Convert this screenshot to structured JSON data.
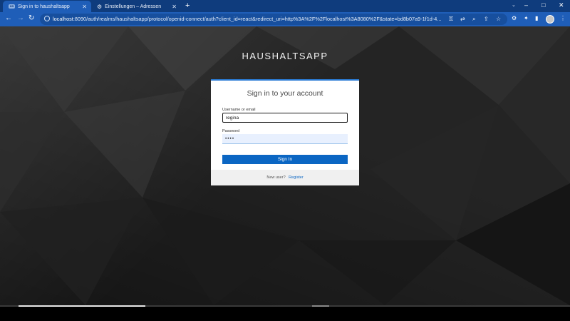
{
  "browser": {
    "tabs": [
      {
        "favicon_text": "HS",
        "label": "Sign in to haushaltsapp",
        "active": true
      },
      {
        "favicon_icon": "gear-icon",
        "label": "Einstellungen – Adressen",
        "active": false
      }
    ],
    "new_tab": "+",
    "window_controls": {
      "minimize": "–",
      "maximize": "□",
      "close": "✕"
    },
    "tab_search": "⌄",
    "nav": {
      "back": "←",
      "forward": "→",
      "reload": "↻"
    },
    "url": {
      "host": "localhost",
      "rest": ":8090/auth/realms/haushaltsapp/protocol/openid-connect/auth?client_id=react&redirect_uri=http%3A%2F%2Flocalhost%3A8080%2F&state=bd8b07a9-1f1d-4..."
    },
    "url_icons": {
      "key": "⚿",
      "translate": "⇄",
      "zoom": "⌕",
      "share": "⇪",
      "bookmark": "☆"
    },
    "extension_icons": {
      "extension_a": "⚙",
      "puzzle": "✦",
      "sidebar": "▮",
      "menu": "⋮"
    }
  },
  "page": {
    "realm_title": "HAUSHALTSAPP",
    "card_title": "Sign in to your account",
    "username_label": "Username or email",
    "username_value": "regina",
    "password_label": "Password",
    "password_value": "••••",
    "signin_label": "Sign In",
    "new_user_text": "New user?",
    "register_label": "Register"
  },
  "colors": {
    "chrome_dark": "#0f3c7d",
    "chrome_light": "#1f5eb8",
    "accent": "#0b66c3",
    "card_border": "#2a7bd5"
  }
}
